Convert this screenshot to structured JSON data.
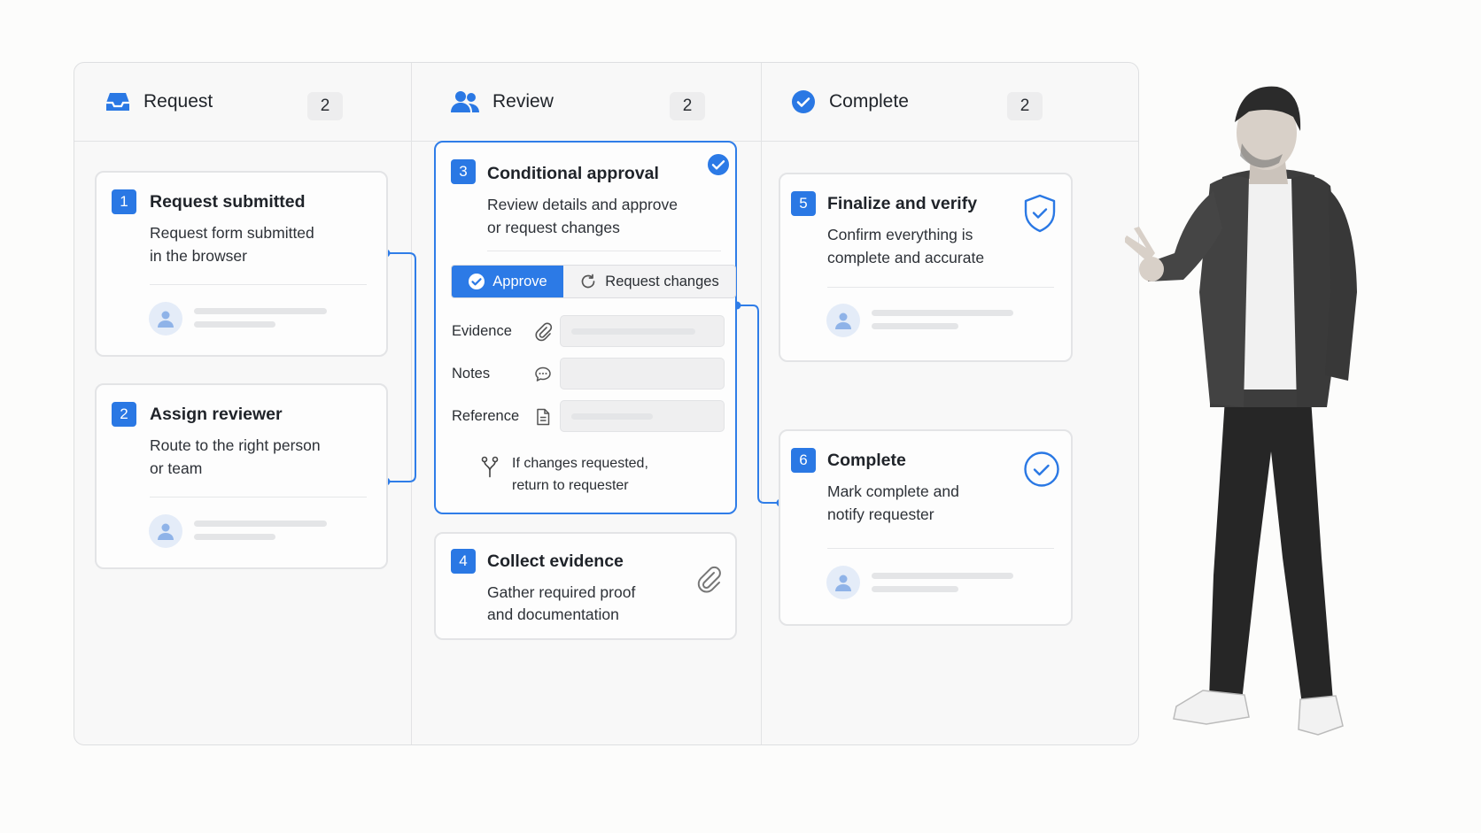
{
  "columns": [
    {
      "title": "Request",
      "count": "2",
      "icon": "inbox-icon"
    },
    {
      "title": "Review",
      "count": "2",
      "icon": "users-icon"
    },
    {
      "title": "Complete",
      "count": "2",
      "icon": "check-circle-icon"
    }
  ],
  "cards": {
    "c1": {
      "num": "1",
      "title": "Request submitted",
      "desc1": "Request form submitted",
      "desc2": "in the browser"
    },
    "c2": {
      "num": "2",
      "title": "Assign reviewer",
      "desc1": "Route to the right person",
      "desc2": "or team"
    },
    "c3": {
      "num": "3",
      "title": "Conditional approval",
      "desc1": "Review details and approve",
      "desc2": "or request changes",
      "approve_label": "Approve",
      "changes_label": "Request changes",
      "fields": {
        "evidence": "Evidence",
        "notes": "Notes",
        "reference": "Reference"
      },
      "note1": "If changes requested,",
      "note2": "return to requester"
    },
    "c4": {
      "num": "4",
      "title": "Collect evidence",
      "desc1": "Gather required proof",
      "desc2": "and documentation"
    },
    "c5": {
      "num": "5",
      "title": "Finalize and verify",
      "desc1": "Confirm everything is",
      "desc2": "complete and accurate"
    },
    "c6": {
      "num": "6",
      "title": "Complete",
      "desc1": "Mark complete and",
      "desc2": "notify requester"
    }
  },
  "colors": {
    "accent": "#2a78e4",
    "border": "#e3e4e6",
    "placeholder": "#e4e5e7"
  }
}
